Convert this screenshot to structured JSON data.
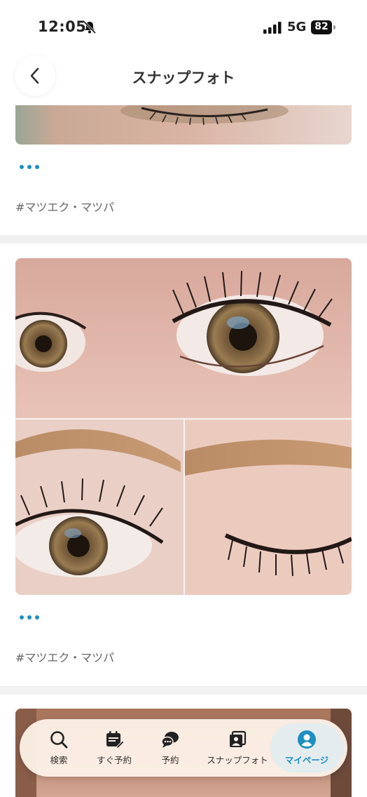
{
  "status": {
    "time": "12:05",
    "network": "5G",
    "battery": "82"
  },
  "header": {
    "title": "スナップフォト"
  },
  "posts": [
    {
      "tag": "#マツエク・マツパ"
    },
    {
      "tag": "#マツエク・マツパ"
    }
  ],
  "nav": {
    "items": [
      {
        "label": "検索",
        "icon": "search-icon"
      },
      {
        "label": "すぐ予約",
        "icon": "calendar-edit-icon"
      },
      {
        "label": "予約",
        "icon": "chat-bubble-icon"
      },
      {
        "label": "スナップフォト",
        "icon": "photo-icon"
      },
      {
        "label": "マイページ",
        "icon": "user-icon"
      }
    ],
    "active": "マイページ"
  },
  "colors": {
    "accent": "#1d8fc0",
    "nav_bg": "#fdf1e8",
    "divider": "#f1f1f1"
  }
}
